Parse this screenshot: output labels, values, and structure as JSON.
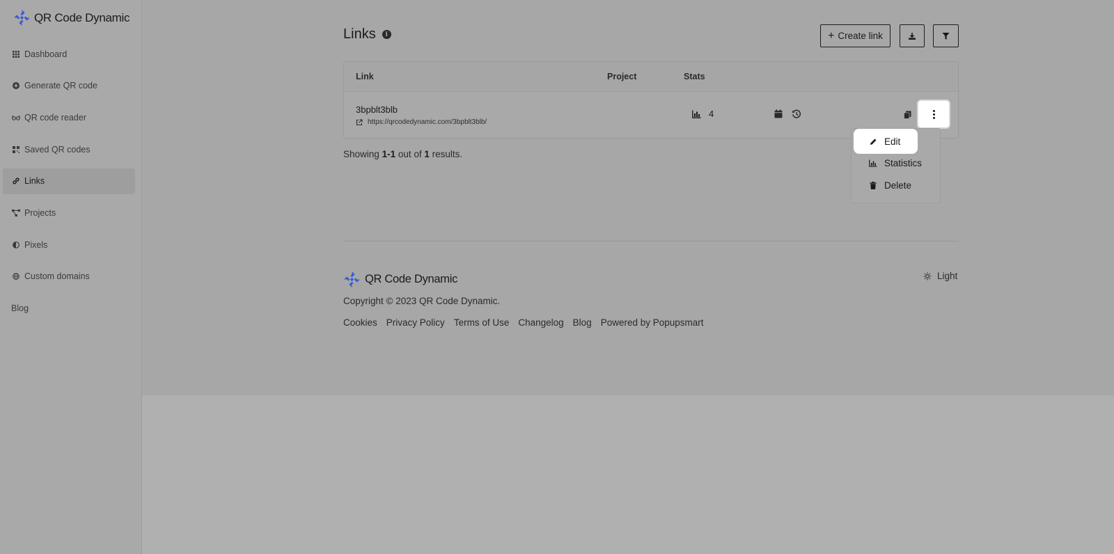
{
  "brand": {
    "name": "QR Code Dynamic"
  },
  "sidebar": {
    "items": [
      {
        "label": "Dashboard",
        "icon": "grid-icon"
      },
      {
        "label": "Generate QR code",
        "icon": "plus-circle-icon"
      },
      {
        "label": "QR code reader",
        "icon": "glasses-icon"
      },
      {
        "label": "Saved QR codes",
        "icon": "qr-icon"
      },
      {
        "label": "Links",
        "icon": "link-icon",
        "active": true
      },
      {
        "label": "Projects",
        "icon": "project-diagram-icon"
      },
      {
        "label": "Pixels",
        "icon": "half-circle-icon"
      },
      {
        "label": "Custom domains",
        "icon": "globe-icon"
      }
    ],
    "blog": "Blog"
  },
  "header": {
    "title": "Links",
    "create_label": "Create link"
  },
  "table": {
    "columns": {
      "link": "Link",
      "project": "Project",
      "stats": "Stats"
    },
    "rows": [
      {
        "title": "3bpblt3blb",
        "url": "https://qrcodedynamic.com/3bpblt3blb/",
        "stats": "4"
      }
    ]
  },
  "results": {
    "prefix": "Showing",
    "range": "1-1",
    "middle": "out of",
    "total": "1",
    "suffix": "results."
  },
  "menu": {
    "edit": "Edit",
    "statistics": "Statistics",
    "delete": "Delete"
  },
  "footer": {
    "brand": "QR Code Dynamic",
    "theme": "Light",
    "copyright": "Copyright © 2023 QR Code Dynamic.",
    "links": [
      "Cookies",
      "Privacy Policy",
      "Terms of Use",
      "Changelog",
      "Blog",
      "Powered by Popupsmart"
    ]
  },
  "colors": {
    "overlay": "#acacac",
    "highlight": "#ffffff",
    "logo_blue": "#3b5bd6"
  }
}
